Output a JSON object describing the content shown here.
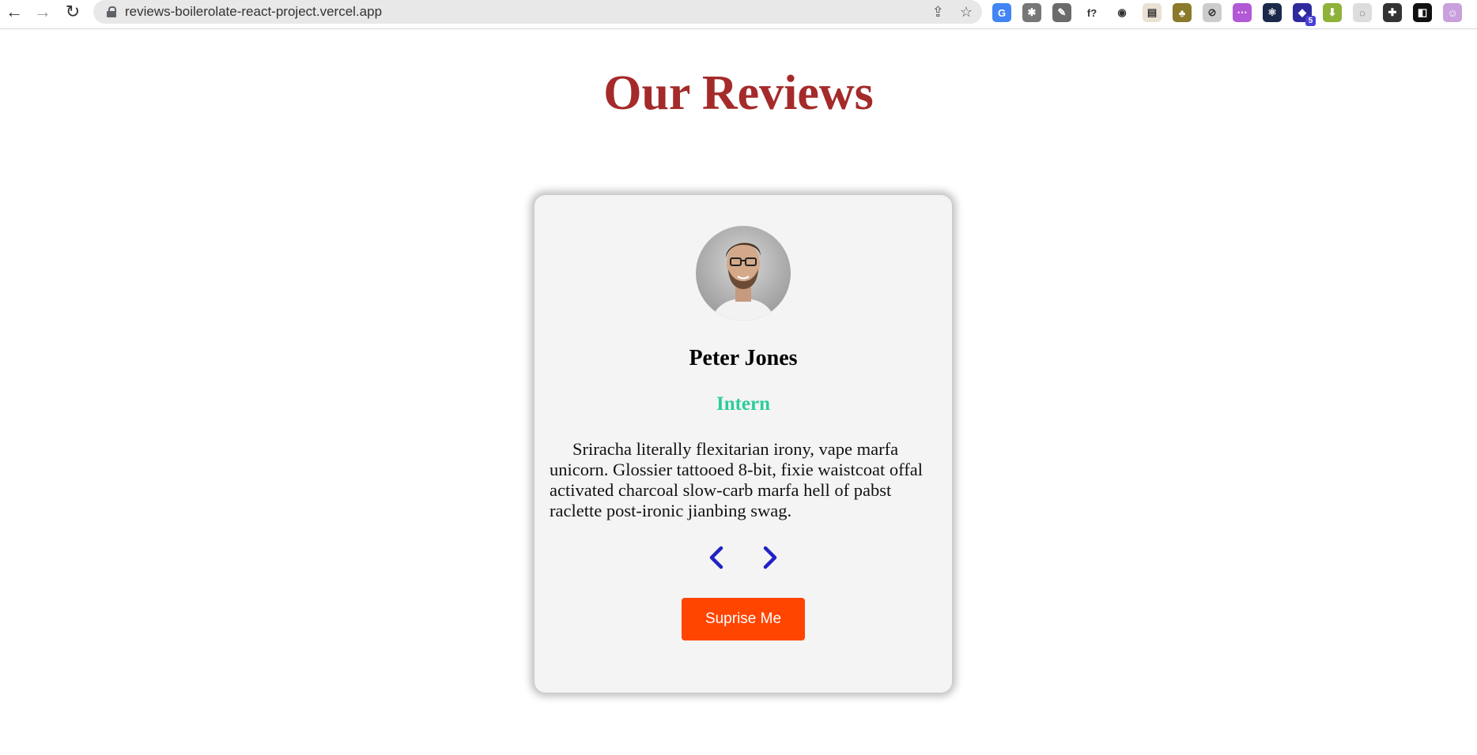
{
  "browser": {
    "url": "reviews-boilerolate-react-project.vercel.app",
    "icons": {
      "back": "back-arrow-icon",
      "forward": "forward-arrow-icon",
      "reload": "reload-icon",
      "share": "share-icon",
      "bookmark": "star-icon"
    },
    "extensions": [
      {
        "name": "google-translate-icon",
        "color": "#4285f4",
        "glyph": "G"
      },
      {
        "name": "bug-icon",
        "color": "#777777",
        "glyph": "✱"
      },
      {
        "name": "color-picker-icon",
        "color": "#6b6b6b",
        "glyph": "✎"
      },
      {
        "name": "font-finder-icon",
        "color": "#ffffff",
        "glyph": "f?"
      },
      {
        "name": "ninja-icon",
        "color": "#ffffff",
        "glyph": "◉"
      },
      {
        "name": "notes-icon",
        "color": "#e9e2d4",
        "glyph": "▤"
      },
      {
        "name": "html-tree-icon",
        "color": "#8a7a2a",
        "glyph": "♣"
      },
      {
        "name": "compass-icon",
        "color": "#cccccc",
        "glyph": "⊘"
      },
      {
        "name": "api-icon",
        "color": "#b25ad6",
        "glyph": "⋯"
      },
      {
        "name": "react-devtools-icon",
        "color": "#1b2a4a",
        "glyph": "⚛"
      },
      {
        "name": "extension-badge-icon",
        "color": "#2f2a9c",
        "glyph": "◆",
        "badge": "5"
      },
      {
        "name": "download-icon",
        "color": "#8fb23a",
        "glyph": "⬇"
      },
      {
        "name": "timer-icon",
        "color": "#dddddd",
        "glyph": "◌"
      },
      {
        "name": "puzzle-icon",
        "color": "#333333",
        "glyph": "✚"
      },
      {
        "name": "side-panel-icon",
        "color": "#111111",
        "glyph": "◧"
      },
      {
        "name": "profile-avatar-icon",
        "color": "#c9a0dc",
        "glyph": "☺"
      }
    ]
  },
  "page": {
    "title": "Our Reviews"
  },
  "review": {
    "name": "Peter Jones",
    "job": "Intern",
    "text": "Sriracha literally flexitarian irony, vape marfa unicorn. Glossier tattooed 8-bit, fixie waistcoat offal activated charcoal slow-carb marfa hell of pabst raclette post-ironic jianbing swag.",
    "prev_icon": "chevron-left-icon",
    "next_icon": "chevron-right-icon",
    "surprise_label": "Suprise Me"
  },
  "colors": {
    "title": "#a52a2a",
    "job": "#2ecc9a",
    "arrows": "#2121c6",
    "button": "#ff4500"
  }
}
